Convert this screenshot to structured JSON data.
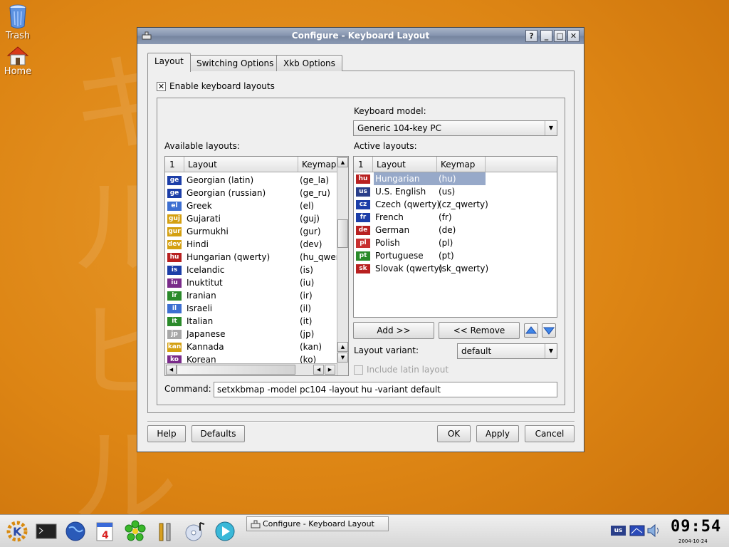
{
  "desktop": {
    "icons": [
      {
        "label": "Trash"
      },
      {
        "label": "Home"
      }
    ]
  },
  "window": {
    "title": "Configure - Keyboard Layout",
    "controls": {
      "help": "?",
      "minimize": "_",
      "maximize": "□",
      "close": "✕"
    },
    "tabs": [
      {
        "label": "Layout",
        "active": true
      },
      {
        "label": "Switching Options",
        "active": false
      },
      {
        "label": "Xkb Options",
        "active": false
      }
    ],
    "enable_layouts": {
      "label": "Enable keyboard layouts",
      "checked": true
    },
    "keyboard_model": {
      "label": "Keyboard model:",
      "value": "Generic 104-key PC"
    },
    "available": {
      "label": "Available layouts:",
      "columns": [
        "1",
        "Layout",
        "Keymap"
      ],
      "rows": [
        {
          "flag": "ge",
          "name": "Georgian (latin)",
          "keymap": "(ge_la)",
          "color": "#1c3ea8"
        },
        {
          "flag": "ge",
          "name": "Georgian (russian)",
          "keymap": "(ge_ru)",
          "color": "#1c3ea8"
        },
        {
          "flag": "el",
          "name": "Greek",
          "keymap": "(el)",
          "color": "#3d6fd1"
        },
        {
          "flag": "guj",
          "name": "Gujarati",
          "keymap": "(guj)",
          "color": "#d4a011"
        },
        {
          "flag": "gur",
          "name": "Gurmukhi",
          "keymap": "(gur)",
          "color": "#d4a011"
        },
        {
          "flag": "dev",
          "name": "Hindi",
          "keymap": "(dev)",
          "color": "#d4a011"
        },
        {
          "flag": "hu",
          "name": "Hungarian (qwerty)",
          "keymap": "(hu_qwer",
          "color": "#b82020"
        },
        {
          "flag": "is",
          "name": "Icelandic",
          "keymap": "(is)",
          "color": "#1c3ea8"
        },
        {
          "flag": "iu",
          "name": "Inuktitut",
          "keymap": "(iu)",
          "color": "#7a2a8a"
        },
        {
          "flag": "ir",
          "name": "Iranian",
          "keymap": "(ir)",
          "color": "#2a8a2a"
        },
        {
          "flag": "il",
          "name": "Israeli",
          "keymap": "(il)",
          "color": "#3d6fd1"
        },
        {
          "flag": "it",
          "name": "Italian",
          "keymap": "(it)",
          "color": "#2a8a2a"
        },
        {
          "flag": "jp",
          "name": "Japanese",
          "keymap": "(jp)",
          "color": "#a8a8a8"
        },
        {
          "flag": "kan",
          "name": "Kannada",
          "keymap": "(kan)",
          "color": "#d4a011"
        },
        {
          "flag": "ko",
          "name": "Korean",
          "keymap": "(ko)",
          "color": "#7a2a8a"
        }
      ]
    },
    "active": {
      "label": "Active layouts:",
      "columns": [
        "1",
        "Layout",
        "Keymap"
      ],
      "rows": [
        {
          "flag": "hu",
          "name": "Hungarian",
          "keymap": "(hu)",
          "color": "#b82020"
        },
        {
          "flag": "us",
          "name": "U.S. English",
          "keymap": "(us)",
          "color": "#2a3f8a"
        },
        {
          "flag": "cz",
          "name": "Czech (qwerty)",
          "keymap": "(cz_qwerty)",
          "color": "#1c3ea8"
        },
        {
          "flag": "fr",
          "name": "French",
          "keymap": "(fr)",
          "color": "#1c3ea8"
        },
        {
          "flag": "de",
          "name": "German",
          "keymap": "(de)",
          "color": "#b82020"
        },
        {
          "flag": "pl",
          "name": "Polish",
          "keymap": "(pl)",
          "color": "#c83030"
        },
        {
          "flag": "pt",
          "name": "Portuguese",
          "keymap": "(pt)",
          "color": "#2a8a2a"
        },
        {
          "flag": "sk",
          "name": "Slovak (qwerty)",
          "keymap": "(sk_qwerty)",
          "color": "#b82020"
        }
      ]
    },
    "add_button": "Add >>",
    "remove_button": "<< Remove",
    "layout_variant": {
      "label": "Layout variant:",
      "value": "default"
    },
    "include_latin": {
      "label": "Include latin layout",
      "checked": false
    },
    "command": {
      "label": "Command:",
      "value": "setxkbmap -model pc104 -layout hu -variant default"
    },
    "buttons": {
      "help": "Help",
      "defaults": "Defaults",
      "ok": "OK",
      "apply": "Apply",
      "cancel": "Cancel"
    }
  },
  "taskbar": {
    "task": "Configure - Keyboard Layout",
    "calendar_day": "4",
    "tray_flag": "us",
    "clock": "09:54",
    "date": "2004-10-24"
  },
  "colors": {
    "accent": "#97a9c9",
    "titlebar": "#8392ad",
    "desktop": "#dd8514"
  }
}
